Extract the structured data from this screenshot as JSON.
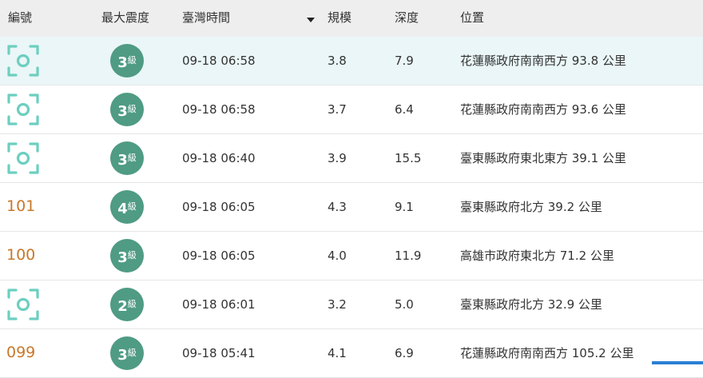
{
  "colors": {
    "header_bg": "#eeeeee",
    "highlight_row_bg": "#eaf6f7",
    "badge_green": "#4f9b84",
    "scan_icon_teal": "#6ccfc0",
    "number_orange": "#c8782a"
  },
  "header": {
    "id": "編號",
    "max_intensity": "最大震度",
    "time": "臺灣時間",
    "magnitude": "規模",
    "depth": "深度",
    "location": "位置",
    "sort_icon": "sort-desc-icon"
  },
  "rows": [
    {
      "id": "",
      "id_icon": "scan-icon",
      "intensity": "3",
      "intensity_unit": "級",
      "time": "09-18 06:58",
      "magnitude": "3.8",
      "depth": "7.9",
      "location": "花蓮縣政府南南西方 93.8 公里"
    },
    {
      "id": "",
      "id_icon": "scan-icon",
      "intensity": "3",
      "intensity_unit": "級",
      "time": "09-18 06:58",
      "magnitude": "3.7",
      "depth": "6.4",
      "location": "花蓮縣政府南南西方 93.6 公里"
    },
    {
      "id": "",
      "id_icon": "scan-icon",
      "intensity": "3",
      "intensity_unit": "級",
      "time": "09-18 06:40",
      "magnitude": "3.9",
      "depth": "15.5",
      "location": "臺東縣政府東北東方 39.1 公里"
    },
    {
      "id": "101",
      "id_icon": "",
      "intensity": "4",
      "intensity_unit": "級",
      "time": "09-18 06:05",
      "magnitude": "4.3",
      "depth": "9.1",
      "location": "臺東縣政府北方 39.2 公里"
    },
    {
      "id": "100",
      "id_icon": "",
      "intensity": "3",
      "intensity_unit": "級",
      "time": "09-18 06:05",
      "magnitude": "4.0",
      "depth": "11.9",
      "location": "高雄市政府東北方 71.2 公里"
    },
    {
      "id": "",
      "id_icon": "scan-icon",
      "intensity": "2",
      "intensity_unit": "級",
      "time": "09-18 06:01",
      "magnitude": "3.2",
      "depth": "5.0",
      "location": "臺東縣政府北方 32.9 公里"
    },
    {
      "id": "099",
      "id_icon": "",
      "intensity": "3",
      "intensity_unit": "級",
      "time": "09-18 05:41",
      "magnitude": "4.1",
      "depth": "6.9",
      "location": "花蓮縣政府南南西方 105.2 公里"
    }
  ]
}
